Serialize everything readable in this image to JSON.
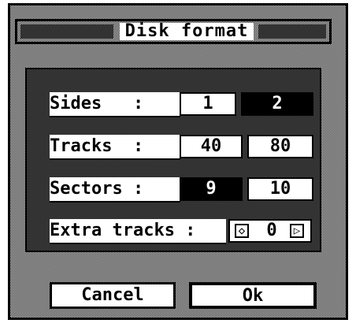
{
  "dialog": {
    "title": "Disk format",
    "rows": {
      "sides": {
        "label": "Sides   :",
        "options": [
          "1",
          "2"
        ],
        "selected": "2"
      },
      "tracks": {
        "label": "Tracks  :",
        "options": [
          "40",
          "80"
        ],
        "selected": "80"
      },
      "sectors": {
        "label": "Sectors :",
        "options": [
          "9",
          "10"
        ],
        "selected": "9"
      },
      "extra": {
        "label": "Extra tracks :",
        "value": "0"
      }
    },
    "buttons": {
      "cancel": "Cancel",
      "ok": "Ok"
    }
  }
}
